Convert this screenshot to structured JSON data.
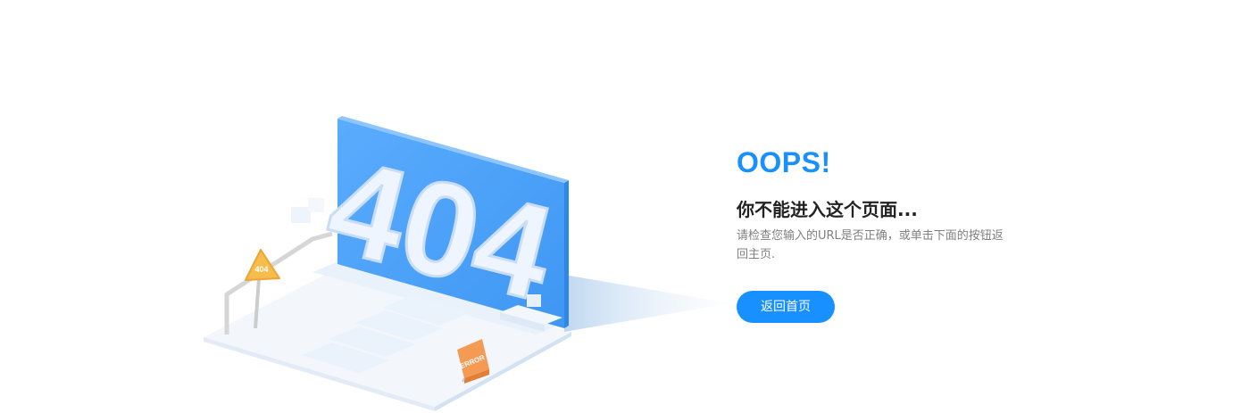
{
  "illustration": {
    "big_text": "404",
    "sign_text": "404",
    "error_board_text": "ERROR"
  },
  "message": {
    "oops": "OOPS!",
    "headline": "你不能进入这个页面...",
    "description": "请检查您输入的URL是否正确，或单击下面的按钮返回主页.",
    "home_button": "返回首页"
  },
  "colors": {
    "accent": "#1890ff",
    "headline": "#222222",
    "description": "#808080",
    "screen_blue": "#4ea5fb",
    "sign_yellow": "#f6bd4a",
    "board_orange": "#f49a52"
  }
}
